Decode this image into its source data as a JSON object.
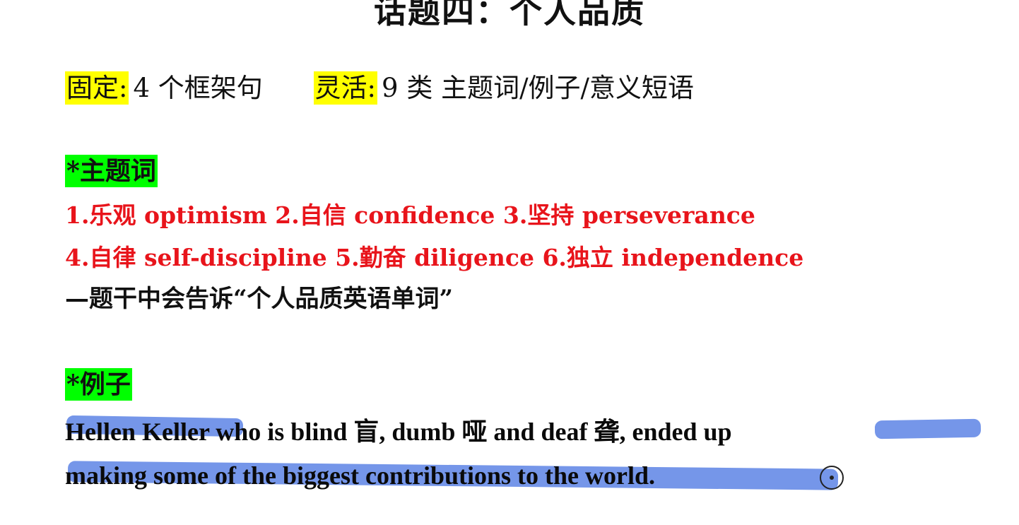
{
  "title": "话题四：个人品质",
  "fixed": {
    "label": "固定:",
    "text": "4 个框架句"
  },
  "flexible": {
    "label": "灵活:",
    "text": "9 类 主题词/例子/意义短语"
  },
  "keywords": {
    "heading": "*主题词",
    "line1": "1.乐观  optimism 2.自信 confidence 3.坚持 perseverance",
    "line2": "4.自律  self-discipline 5.勤奋 diligence 6.独立 independence",
    "note": "—题干中会告诉“个人品质英语单词”"
  },
  "example": {
    "heading": "*例子",
    "line1": "Hellen Keller who is blind 盲, dumb 哑  and deaf 聋, ended up",
    "line2": "making some of the biggest contributions to the world."
  },
  "colors": {
    "highlight_yellow": "#ffff00",
    "highlight_green": "#00ff00",
    "keyword_red": "#e8141b",
    "annotation_blue": "#406ee0"
  }
}
